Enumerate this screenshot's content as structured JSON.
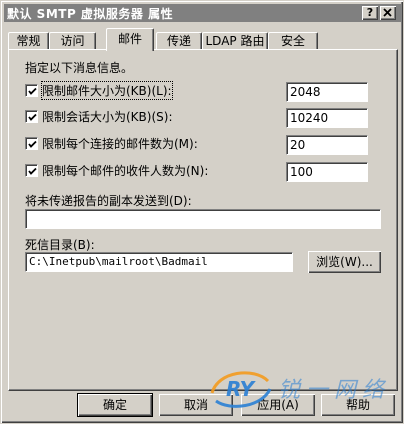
{
  "window": {
    "title": "默认 SMTP 虚拟服务器 属性",
    "help_button": "?",
    "close_button": "×"
  },
  "tabs": [
    {
      "label": "常规",
      "active": false
    },
    {
      "label": "访问",
      "active": false
    },
    {
      "label": "邮件",
      "active": true
    },
    {
      "label": "传递",
      "active": false
    },
    {
      "label": "LDAP 路由",
      "active": false
    },
    {
      "label": "安全",
      "active": false
    }
  ],
  "mail": {
    "instruction": "指定以下消息信息。",
    "limits": [
      {
        "label": "限制邮件大小为(KB)(L):",
        "checked": true,
        "value": "2048"
      },
      {
        "label": "限制会话大小为(KB)(S):",
        "checked": true,
        "value": "10240"
      },
      {
        "label": "限制每个连接的邮件数为(M):",
        "checked": true,
        "value": "20"
      },
      {
        "label": "限制每个邮件的收件人数为(N):",
        "checked": true,
        "value": "100"
      }
    ],
    "ndr_label": "将未传递报告的副本发送到(D):",
    "ndr_value": "",
    "badmail_label": "死信目录(B):",
    "badmail_value": "C:\\Inetpub\\mailroot\\Badmail",
    "browse_label": "浏览(W)..."
  },
  "footer": {
    "ok_label": "确定",
    "cancel_label": "取消",
    "apply_label": "应用(A)",
    "help_label": "帮助"
  },
  "watermark": {
    "logo_text": "RY",
    "slogan": "锐一网络"
  },
  "colors": {
    "face": "#d4d0c8",
    "inactive_title": "#808080",
    "watermark_blue": "#2a7fd4",
    "watermark_orange": "#f39a1e"
  }
}
